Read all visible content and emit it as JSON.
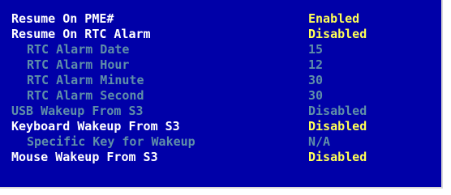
{
  "colors": {
    "background": "#0000a8",
    "active_label": "#ffffff",
    "active_value": "#ffff55",
    "disabled_text": "#5f8fa8"
  },
  "settings": [
    {
      "label": "Resume On PME#",
      "value": "Enabled",
      "state": "active"
    },
    {
      "label": "Resume On RTC Alarm",
      "value": "Disabled",
      "state": "active"
    },
    {
      "label": "RTC Alarm Date",
      "value": "15",
      "state": "dim"
    },
    {
      "label": "RTC Alarm Hour",
      "value": "12",
      "state": "dim"
    },
    {
      "label": "RTC Alarm Minute",
      "value": "30",
      "state": "dim"
    },
    {
      "label": "RTC Alarm Second",
      "value": "30",
      "state": "dim"
    },
    {
      "label": "USB Wakeup From S3",
      "value": "Disabled",
      "state": "dim"
    },
    {
      "label": "Keyboard Wakeup From S3",
      "value": "Disabled",
      "state": "active"
    },
    {
      "label": "Specific Key for Wakeup",
      "value": "N/A",
      "state": "dim"
    },
    {
      "label": "Mouse Wakeup From S3",
      "value": "Disabled",
      "state": "active"
    }
  ]
}
